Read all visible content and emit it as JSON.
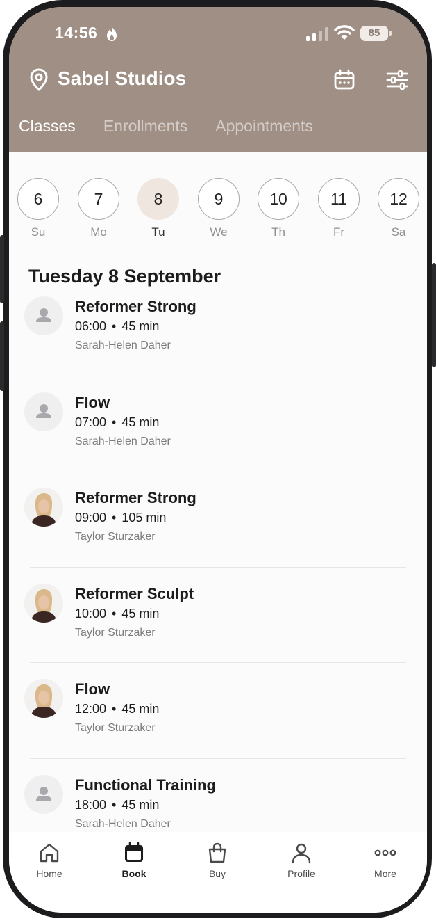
{
  "status_bar": {
    "time": "14:56",
    "battery": "85"
  },
  "header": {
    "studio_name": "Sabel Studios",
    "icons": [
      "location-pin-icon",
      "calendar-icon",
      "filter-sliders-icon"
    ],
    "tabs": [
      {
        "label": "Classes",
        "active": true
      },
      {
        "label": "Enrollments",
        "active": false
      },
      {
        "label": "Appointments",
        "active": false
      }
    ],
    "background_color": "#a08f85"
  },
  "week": {
    "days": [
      {
        "num": "6",
        "abbr": "Su",
        "selected": false
      },
      {
        "num": "7",
        "abbr": "Mo",
        "selected": false
      },
      {
        "num": "8",
        "abbr": "Tu",
        "selected": true
      },
      {
        "num": "9",
        "abbr": "We",
        "selected": false
      },
      {
        "num": "10",
        "abbr": "Th",
        "selected": false
      },
      {
        "num": "11",
        "abbr": "Fr",
        "selected": false
      },
      {
        "num": "12",
        "abbr": "Sa",
        "selected": false
      }
    ],
    "selected_color": "#f0e6e0"
  },
  "date_heading": "Tuesday 8 September",
  "classes": [
    {
      "name": "Reformer Strong",
      "time": "06:00",
      "duration": "45 min",
      "teacher": "Sarah-Helen Daher",
      "avatar": "placeholder"
    },
    {
      "name": "Flow",
      "time": "07:00",
      "duration": "45 min",
      "teacher": "Sarah-Helen Daher",
      "avatar": "placeholder"
    },
    {
      "name": "Reformer Strong",
      "time": "09:00",
      "duration": "105 min",
      "teacher": "Taylor Sturzaker",
      "avatar": "photo"
    },
    {
      "name": "Reformer Sculpt",
      "time": "10:00",
      "duration": "45 min",
      "teacher": "Taylor Sturzaker",
      "avatar": "photo"
    },
    {
      "name": "Flow",
      "time": "12:00",
      "duration": "45 min",
      "teacher": "Taylor Sturzaker",
      "avatar": "photo"
    },
    {
      "name": "Functional Training",
      "time": "18:00",
      "duration": "45 min",
      "teacher": "Sarah-Helen Daher",
      "avatar": "placeholder"
    }
  ],
  "tabbar": {
    "items": [
      {
        "label": "Home",
        "icon": "home-icon",
        "active": false
      },
      {
        "label": "Book",
        "icon": "calendar-icon",
        "active": true
      },
      {
        "label": "Buy",
        "icon": "shopping-bag-icon",
        "active": false
      },
      {
        "label": "Profile",
        "icon": "person-icon",
        "active": false
      },
      {
        "label": "More",
        "icon": "more-dots-icon",
        "active": false
      }
    ]
  }
}
